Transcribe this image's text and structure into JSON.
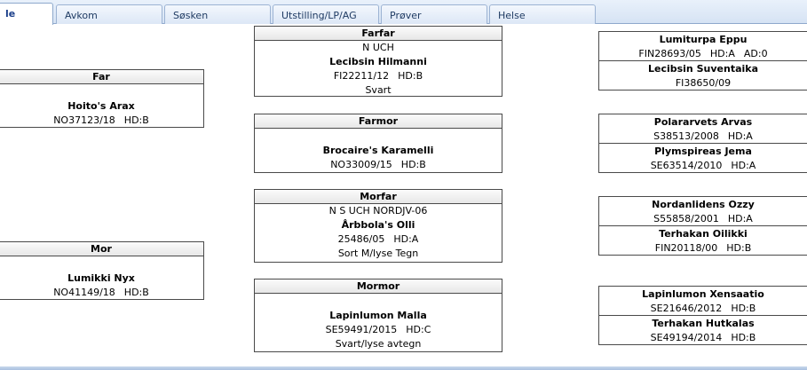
{
  "tabs": [
    {
      "label": "le",
      "active": true
    },
    {
      "label": "Avkom"
    },
    {
      "label": "Søsken"
    },
    {
      "label": "Utstilling/LP/AG"
    },
    {
      "label": "Prøver"
    },
    {
      "label": "Helse"
    }
  ],
  "generation1": {
    "far": {
      "title": "Far",
      "name": "Hoito's Arax",
      "reg": "NO37123/18",
      "hd": "HD:B"
    },
    "mor": {
      "title": "Mor",
      "name": "Lumikki Nyx",
      "reg": "NO41149/18",
      "hd": "HD:B"
    }
  },
  "generation2": {
    "farfar": {
      "title": "Farfar",
      "titles": "N UCH",
      "name": "Lecibsin Hilmanni",
      "reg": "FI22211/12",
      "hd": "HD:B",
      "color": "Svart"
    },
    "farmor": {
      "title": "Farmor",
      "name": "Brocaire's Karamelli",
      "reg": "NO33009/15",
      "hd": "HD:B"
    },
    "morfar": {
      "title": "Morfar",
      "titles": "N S UCH NORDJV-06",
      "name": "Årbbola's Olli",
      "reg": "25486/05",
      "hd": "HD:A",
      "color": "Sort M/lyse Tegn"
    },
    "mormor": {
      "title": "Mormor",
      "name": "Lapinlumon Malla",
      "reg": "SE59491/2015",
      "hd": "HD:C",
      "color": "Svart/lyse avtegn"
    }
  },
  "generation3": [
    {
      "top": {
        "name": "Lumiturpa Eppu",
        "reg": "FIN28693/05",
        "hd": "HD:A",
        "ad": "AD:0"
      },
      "bottom": {
        "name": "Lecibsin Suventaika",
        "reg": "FI38650/09"
      }
    },
    {
      "top": {
        "name": "Polararvets Arvas",
        "reg": "S38513/2008",
        "hd": "HD:A"
      },
      "bottom": {
        "name": "Plymspireas Jema",
        "reg": "SE63514/2010",
        "hd": "HD:A"
      }
    },
    {
      "top": {
        "name": "Nordanlidens Ozzy",
        "reg": "S55858/2001",
        "hd": "HD:A"
      },
      "bottom": {
        "name": "Terhakan Oilikki",
        "reg": "FIN20118/00",
        "hd": "HD:B"
      }
    },
    {
      "top": {
        "name": "Lapinlumon Xensaatio",
        "reg": "SE21646/2012",
        "hd": "HD:B"
      },
      "bottom": {
        "name": "Terhakan Hutkalas",
        "reg": "SE49194/2014",
        "hd": "HD:B"
      }
    }
  ]
}
